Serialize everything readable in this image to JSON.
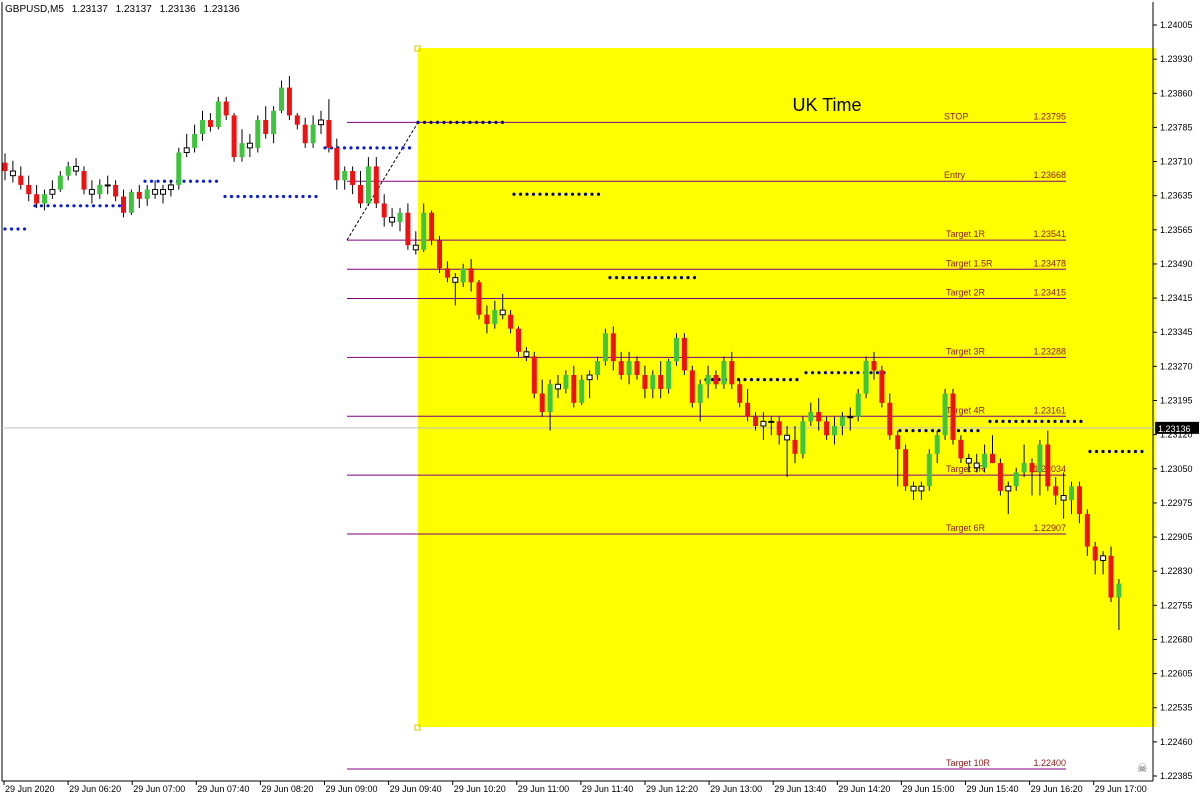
{
  "header": {
    "symbol": "GBPUSD,M5",
    "open": "1.23137",
    "high": "1.23137",
    "low": "1.23136",
    "close": "1.23136"
  },
  "colors": {
    "background": "#ffffff",
    "session_box": "#ffff00",
    "bull_candle": "#3ec43e",
    "bear_candle": "#ee1111",
    "doji_candle": "#ffffff",
    "wick": "#000000",
    "level_line": "#800080",
    "level_text": "#8b1a1a",
    "dots_blue": "#0a1ed8",
    "dots_dark": "#00008b",
    "current_price_line": "#c0c0c0",
    "price_tag_bg": "#000000",
    "price_tag_text": "#ffffff"
  },
  "chart_data": {
    "type": "candlestick",
    "symbol": "GBPUSD",
    "timeframe": "M5",
    "y_ticks": [
      "1.24005",
      "1.23930",
      "1.23860",
      "1.23785",
      "1.23710",
      "1.23635",
      "1.23565",
      "1.23490",
      "1.23415",
      "1.23345",
      "1.23270",
      "1.23195",
      "1.23120",
      "1.23050",
      "1.22975",
      "1.22905",
      "1.22830",
      "1.22755",
      "1.22680",
      "1.22605",
      "1.22535",
      "1.22460",
      "1.22385"
    ],
    "ylim": [
      1.2238,
      1.2401
    ],
    "x_ticks": [
      "29 Jun 2020",
      "29 Jun 06:20",
      "29 Jun 07:00",
      "29 Jun 07:40",
      "29 Jun 08:20",
      "29 Jun 09:00",
      "29 Jun 09:40",
      "29 Jun 10:20",
      "29 Jun 11:00",
      "29 Jun 11:40",
      "29 Jun 12:20",
      "29 Jun 13:00",
      "29 Jun 13:40",
      "29 Jun 14:20",
      "29 Jun 15:00",
      "29 Jun 15:40",
      "29 Jun 16:20",
      "29 Jun 17:00"
    ],
    "current_price": "1.23136",
    "session_label": "UK Time",
    "levels": [
      {
        "label": "STOP",
        "value": "1.23795"
      },
      {
        "label": "Entry",
        "value": "1.23668"
      },
      {
        "label": "Target 1R",
        "value": "1.23541"
      },
      {
        "label": "Target 1.5R",
        "value": "1.23478"
      },
      {
        "label": "Target 2R",
        "value": "1.23415"
      },
      {
        "label": "Target 3R",
        "value": "1.23288"
      },
      {
        "label": "Target 4R",
        "value": "1.23161"
      },
      {
        "label": "Target 5R",
        "value": "1.23034"
      },
      {
        "label": "Target 6R",
        "value": "1.22907"
      },
      {
        "label": "Target 10R",
        "value": "1.22400"
      }
    ],
    "candles": [
      [
        1.23708,
        1.23728,
        1.2367,
        1.2369
      ],
      [
        1.2369,
        1.23712,
        1.23665,
        1.2368
      ],
      [
        1.2368,
        1.237,
        1.2365,
        1.2366
      ],
      [
        1.2366,
        1.2368,
        1.23625,
        1.2364
      ],
      [
        1.2364,
        1.2366,
        1.2361,
        1.2362
      ],
      [
        1.2362,
        1.2365,
        1.23605,
        1.2364
      ],
      [
        1.2364,
        1.2367,
        1.2363,
        1.2365
      ],
      [
        1.2365,
        1.2369,
        1.23645,
        1.2368
      ],
      [
        1.2368,
        1.2371,
        1.2367,
        1.237
      ],
      [
        1.237,
        1.23718,
        1.2368,
        1.2369
      ],
      [
        1.2369,
        1.237,
        1.2364,
        1.2365
      ],
      [
        1.2365,
        1.2367,
        1.2362,
        1.2364
      ],
      [
        1.2364,
        1.23672,
        1.2363,
        1.2366
      ],
      [
        1.2366,
        1.2368,
        1.2364,
        1.2366
      ],
      [
        1.2366,
        1.2367,
        1.23625,
        1.23635
      ],
      [
        1.23635,
        1.2365,
        1.2359,
        1.236
      ],
      [
        1.236,
        1.2365,
        1.23595,
        1.23645
      ],
      [
        1.23645,
        1.2366,
        1.2361,
        1.2363
      ],
      [
        1.2363,
        1.2366,
        1.23615,
        1.2365
      ],
      [
        1.2365,
        1.2367,
        1.2363,
        1.2364
      ],
      [
        1.2364,
        1.2366,
        1.2362,
        1.2365
      ],
      [
        1.2365,
        1.2367,
        1.23635,
        1.2366
      ],
      [
        1.2366,
        1.2374,
        1.2365,
        1.2373
      ],
      [
        1.2373,
        1.2377,
        1.2372,
        1.2374
      ],
      [
        1.2374,
        1.2379,
        1.2373,
        1.2377
      ],
      [
        1.2377,
        1.2382,
        1.23755,
        1.238
      ],
      [
        1.238,
        1.23815,
        1.23775,
        1.23785
      ],
      [
        1.23785,
        1.2385,
        1.2378,
        1.2384
      ],
      [
        1.2384,
        1.2385,
        1.238,
        1.2381
      ],
      [
        1.2381,
        1.23815,
        1.2371,
        1.2372
      ],
      [
        1.2372,
        1.2378,
        1.2371,
        1.2375
      ],
      [
        1.2375,
        1.2377,
        1.2372,
        1.2374
      ],
      [
        1.2374,
        1.2381,
        1.2373,
        1.238
      ],
      [
        1.238,
        1.2383,
        1.2376,
        1.2377
      ],
      [
        1.2377,
        1.2383,
        1.2375,
        1.2382
      ],
      [
        1.2382,
        1.23885,
        1.23815,
        1.2387
      ],
      [
        1.2387,
        1.23895,
        1.238,
        1.2381
      ],
      [
        1.2381,
        1.23815,
        1.2378,
        1.2379
      ],
      [
        1.2379,
        1.23805,
        1.2374,
        1.2375
      ],
      [
        1.2375,
        1.2381,
        1.2374,
        1.2379
      ],
      [
        1.2379,
        1.2382,
        1.2377,
        1.238
      ],
      [
        1.238,
        1.23845,
        1.2373,
        1.2374
      ],
      [
        1.2374,
        1.2376,
        1.2365,
        1.2367
      ],
      [
        1.2367,
        1.237,
        1.2365,
        1.2369
      ],
      [
        1.2369,
        1.237,
        1.2364,
        1.2366
      ],
      [
        1.2366,
        1.2369,
        1.2361,
        1.2362
      ],
      [
        1.2362,
        1.2372,
        1.23615,
        1.237
      ],
      [
        1.237,
        1.2372,
        1.2361,
        1.2362
      ],
      [
        1.2362,
        1.2364,
        1.2357,
        1.2359
      ],
      [
        1.2359,
        1.2361,
        1.2357,
        1.2358
      ],
      [
        1.2358,
        1.2361,
        1.2356,
        1.236
      ],
      [
        1.236,
        1.2362,
        1.2352,
        1.2353
      ],
      [
        1.2353,
        1.2356,
        1.2351,
        1.2352
      ],
      [
        1.2352,
        1.2362,
        1.23515,
        1.236
      ],
      [
        1.236,
        1.23605,
        1.2353,
        1.2354
      ],
      [
        1.2354,
        1.2355,
        1.2347,
        1.2348
      ],
      [
        1.2348,
        1.23495,
        1.2345,
        1.2346
      ],
      [
        1.2346,
        1.2347,
        1.234,
        1.2345
      ],
      [
        1.2345,
        1.2349,
        1.2344,
        1.2348
      ],
      [
        1.2348,
        1.235,
        1.2343,
        1.2345
      ],
      [
        1.2345,
        1.23455,
        1.2337,
        1.2338
      ],
      [
        1.2338,
        1.234,
        1.2334,
        1.2336
      ],
      [
        1.2336,
        1.2341,
        1.2335,
        1.2339
      ],
      [
        1.2339,
        1.23425,
        1.2337,
        1.2338
      ],
      [
        1.2338,
        1.2339,
        1.2334,
        1.2335
      ],
      [
        1.2335,
        1.23355,
        1.2329,
        1.233
      ],
      [
        1.233,
        1.2331,
        1.2328,
        1.2329
      ],
      [
        1.2329,
        1.233,
        1.232,
        1.2321
      ],
      [
        1.2321,
        1.2324,
        1.2316,
        1.2317
      ],
      [
        1.2317,
        1.2324,
        1.2313,
        1.2323
      ],
      [
        1.2323,
        1.2325,
        1.232,
        1.2322
      ],
      [
        1.2322,
        1.2326,
        1.2321,
        1.2325
      ],
      [
        1.2325,
        1.2327,
        1.2318,
        1.2319
      ],
      [
        1.2319,
        1.2325,
        1.23185,
        1.2324
      ],
      [
        1.2324,
        1.2326,
        1.232,
        1.2325
      ],
      [
        1.2325,
        1.2329,
        1.2324,
        1.2328
      ],
      [
        1.2328,
        1.2335,
        1.2327,
        1.2334
      ],
      [
        1.2334,
        1.23355,
        1.2326,
        1.2328
      ],
      [
        1.2328,
        1.233,
        1.2324,
        1.2325
      ],
      [
        1.2325,
        1.233,
        1.2323,
        1.2328
      ],
      [
        1.2328,
        1.2329,
        1.2324,
        1.2325
      ],
      [
        1.2325,
        1.2327,
        1.232,
        1.2322
      ],
      [
        1.2322,
        1.2326,
        1.232,
        1.2325
      ],
      [
        1.2325,
        1.2328,
        1.232,
        1.2322
      ],
      [
        1.2322,
        1.23285,
        1.2321,
        1.2328
      ],
      [
        1.2328,
        1.2334,
        1.2327,
        1.2333
      ],
      [
        1.2333,
        1.2334,
        1.2325,
        1.2326
      ],
      [
        1.2326,
        1.2327,
        1.2318,
        1.2319
      ],
      [
        1.2319,
        1.2324,
        1.2315,
        1.2323
      ],
      [
        1.2323,
        1.2327,
        1.232,
        1.2325
      ],
      [
        1.2325,
        1.2326,
        1.2322,
        1.2323
      ],
      [
        1.2323,
        1.2329,
        1.2322,
        1.2328
      ],
      [
        1.2328,
        1.233,
        1.2322,
        1.2323
      ],
      [
        1.2323,
        1.2324,
        1.2318,
        1.2319
      ],
      [
        1.2319,
        1.2322,
        1.2315,
        1.2316
      ],
      [
        1.2316,
        1.2317,
        1.2313,
        1.2314
      ],
      [
        1.2314,
        1.2317,
        1.2311,
        1.2315
      ],
      [
        1.2315,
        1.2316,
        1.2312,
        1.2315
      ],
      [
        1.2315,
        1.2316,
        1.231,
        1.2312
      ],
      [
        1.2312,
        1.2314,
        1.2303,
        1.2311
      ],
      [
        1.2311,
        1.2314,
        1.2306,
        1.2308
      ],
      [
        1.2308,
        1.2316,
        1.2307,
        1.2315
      ],
      [
        1.2315,
        1.2319,
        1.2314,
        1.2317
      ],
      [
        1.2317,
        1.232,
        1.2313,
        1.2315
      ],
      [
        1.2315,
        1.2316,
        1.2311,
        1.2312
      ],
      [
        1.2312,
        1.2316,
        1.231,
        1.2314
      ],
      [
        1.2314,
        1.2317,
        1.2312,
        1.2316
      ],
      [
        1.2316,
        1.2318,
        1.2313,
        1.2316
      ],
      [
        1.2316,
        1.2322,
        1.2315,
        1.2321
      ],
      [
        1.2321,
        1.2329,
        1.232,
        1.2328
      ],
      [
        1.2328,
        1.233,
        1.2324,
        1.2326
      ],
      [
        1.2326,
        1.2327,
        1.2318,
        1.2319
      ],
      [
        1.2319,
        1.2321,
        1.2311,
        1.2312
      ],
      [
        1.2312,
        1.2313,
        1.2301,
        1.2309
      ],
      [
        1.2309,
        1.231,
        1.23,
        1.2301
      ],
      [
        1.2301,
        1.2302,
        1.2298,
        1.23
      ],
      [
        1.23,
        1.2302,
        1.2298,
        1.2301
      ],
      [
        1.2301,
        1.2309,
        1.23,
        1.2308
      ],
      [
        1.2308,
        1.2313,
        1.2306,
        1.2312
      ],
      [
        1.2312,
        1.2322,
        1.2311,
        1.2321
      ],
      [
        1.2321,
        1.2322,
        1.231,
        1.2311
      ],
      [
        1.2311,
        1.2312,
        1.2306,
        1.2307
      ],
      [
        1.2307,
        1.2308,
        1.2304,
        1.2306
      ],
      [
        1.2306,
        1.2308,
        1.2304,
        1.2305
      ],
      [
        1.2305,
        1.231,
        1.2304,
        1.2308
      ],
      [
        1.2308,
        1.2312,
        1.2306,
        1.2306
      ],
      [
        1.2306,
        1.2307,
        1.2299,
        1.23
      ],
      [
        1.23,
        1.2302,
        1.2295,
        1.2301
      ],
      [
        1.2301,
        1.2305,
        1.23,
        1.2304
      ],
      [
        1.2304,
        1.231,
        1.2303,
        1.2306
      ],
      [
        1.2306,
        1.2307,
        1.2299,
        1.2304
      ],
      [
        1.2304,
        1.2311,
        1.2299,
        1.231
      ],
      [
        1.231,
        1.2313,
        1.23,
        1.2301
      ],
      [
        1.2301,
        1.2303,
        1.2297,
        1.2299
      ],
      [
        1.2299,
        1.2304,
        1.2294,
        1.2298
      ],
      [
        1.2298,
        1.2302,
        1.2295,
        1.2301
      ],
      [
        1.2301,
        1.2302,
        1.2293,
        1.2295
      ],
      [
        1.2295,
        1.2296,
        1.2286,
        1.2288
      ],
      [
        1.2288,
        1.2289,
        1.2282,
        1.2285
      ],
      [
        1.2285,
        1.2287,
        1.2282,
        1.2286
      ],
      [
        1.2286,
        1.2288,
        1.2276,
        1.2277
      ],
      [
        1.2277,
        1.2281,
        1.227,
        1.228
      ]
    ]
  }
}
